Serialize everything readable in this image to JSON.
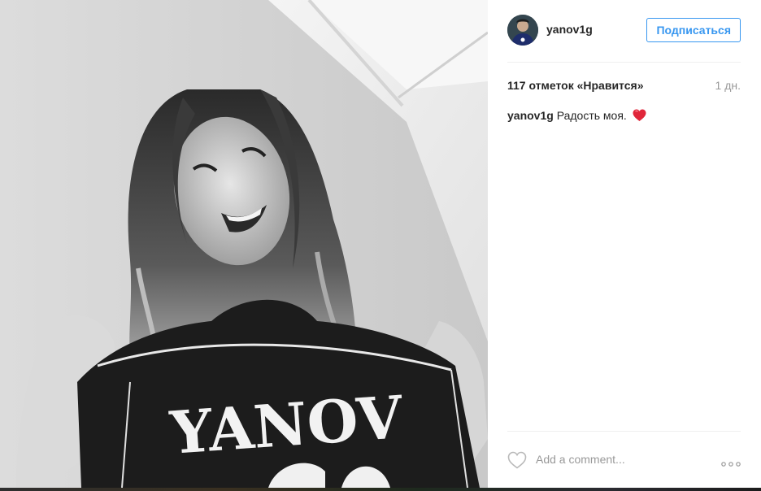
{
  "post": {
    "photo": {
      "alt_icon": "photo-image",
      "jersey_text": "YANOV"
    },
    "author": {
      "username": "yanov1g",
      "avatar_icon": "user-avatar"
    },
    "follow_label": "Подписаться",
    "likes_text": "117 отметок «Нравится»",
    "time_text": "1 дн.",
    "caption": {
      "username": "yanov1g",
      "text": "Радость моя.",
      "emoji_icon": "red-heart-emoji"
    },
    "comment_placeholder": "Add a comment...",
    "icons": {
      "like": "heart-outline-icon",
      "more": "more-options-icon"
    }
  },
  "colors": {
    "accent": "#3897f0",
    "text": "#262626",
    "muted": "#999999",
    "divider": "#efefef",
    "heart": "#e0263a"
  }
}
